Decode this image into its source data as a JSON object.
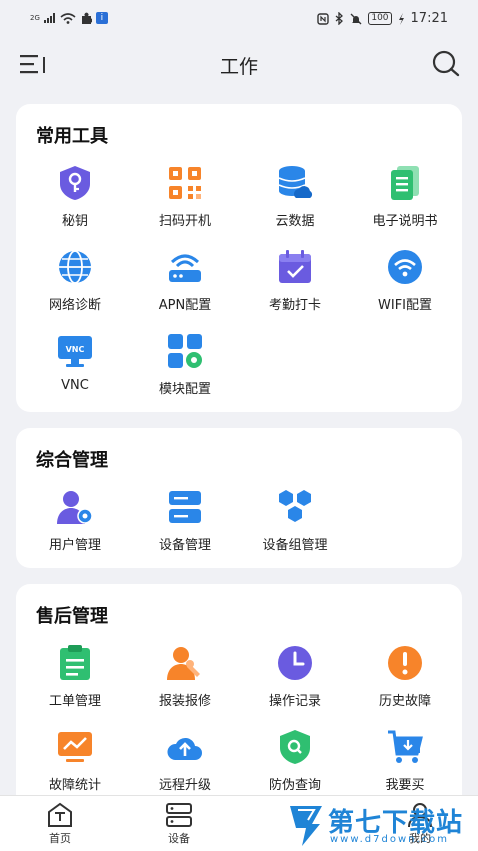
{
  "status_bar": {
    "net": "2G",
    "time": "17:21",
    "battery": "100"
  },
  "header": {
    "title": "工作"
  },
  "sections": [
    {
      "title": "常用工具",
      "items": [
        "秘钥",
        "扫码开机",
        "云数据",
        "电子说明书",
        "网络诊断",
        "APN配置",
        "考勤打卡",
        "WIFI配置",
        "VNC",
        "模块配置"
      ]
    },
    {
      "title": "综合管理",
      "items": [
        "用户管理",
        "设备管理",
        "设备组管理"
      ]
    },
    {
      "title": "售后管理",
      "items": [
        "工单管理",
        "报装报修",
        "操作记录",
        "历史故障",
        "故障统计",
        "远程升级",
        "防伪查询",
        "我要买"
      ]
    }
  ],
  "icons": {
    "key": "key-icon",
    "qr": "qr-code-icon",
    "cloud_db": "cloud-database-icon",
    "manual": "manual-icon",
    "network": "globe-icon",
    "apn": "router-icon",
    "attendance": "calendar-check-icon",
    "wifi": "wifi-icon",
    "vnc": "monitor-vnc-icon",
    "module": "module-settings-icon",
    "user": "user-settings-icon",
    "device": "server-icon",
    "device_group": "hexagon-group-icon",
    "workorder": "clipboard-icon",
    "repair": "wrench-person-icon",
    "oplog": "clock-icon",
    "fault": "alert-icon",
    "stats": "chart-monitor-icon",
    "upgrade": "cloud-upload-icon",
    "antifake": "shield-search-icon",
    "buy": "cart-icon"
  },
  "tabbar": [
    "首页",
    "设备",
    "我的"
  ],
  "watermark": {
    "name": "第七下载站",
    "url": "www.d7down.com"
  },
  "colors": {
    "blue": "#2a86e8",
    "orange": "#f7842a",
    "green": "#2fbf71",
    "purple": "#6a5be0"
  }
}
